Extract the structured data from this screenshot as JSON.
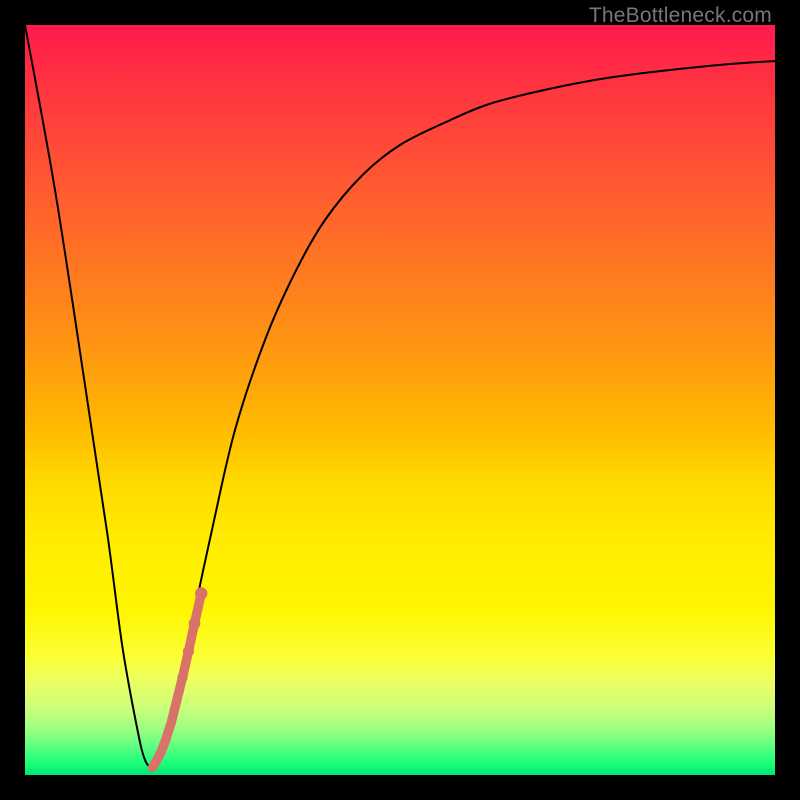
{
  "watermark": "TheBottleneck.com",
  "colors": {
    "gradient_top": "#ff1a4d",
    "gradient_bottom": "#00e673",
    "curve": "#000000",
    "markers": "#d9736a",
    "frame": "#000000"
  },
  "chart_data": {
    "type": "line",
    "title": "",
    "xlabel": "",
    "ylabel": "",
    "xlim": [
      0,
      100
    ],
    "ylim": [
      0,
      100
    ],
    "grid": false,
    "legend": false,
    "series": [
      {
        "name": "bottleneck-curve",
        "x": [
          0,
          4,
          8,
          11,
          13,
          15,
          16,
          17,
          18,
          20,
          22,
          25,
          28,
          32,
          36,
          40,
          45,
          50,
          56,
          62,
          70,
          78,
          86,
          94,
          100
        ],
        "y": [
          100,
          78,
          52,
          32,
          17,
          6,
          2,
          1,
          2,
          9,
          19,
          33,
          46,
          58,
          67,
          74,
          80,
          84,
          87,
          89.5,
          91.5,
          93,
          94,
          94.8,
          95.2
        ]
      }
    ],
    "markers": {
      "name": "highlight-dots",
      "x": [
        17.0,
        17.6,
        18.2,
        18.8,
        19.5,
        20.2,
        21.0,
        21.8,
        22.6,
        23.5
      ],
      "y": [
        1.0,
        2.0,
        3.2,
        4.8,
        7.0,
        9.8,
        13.0,
        16.5,
        20.2,
        24.2
      ],
      "radius_start": 3.2,
      "radius_end": 6.2
    }
  }
}
